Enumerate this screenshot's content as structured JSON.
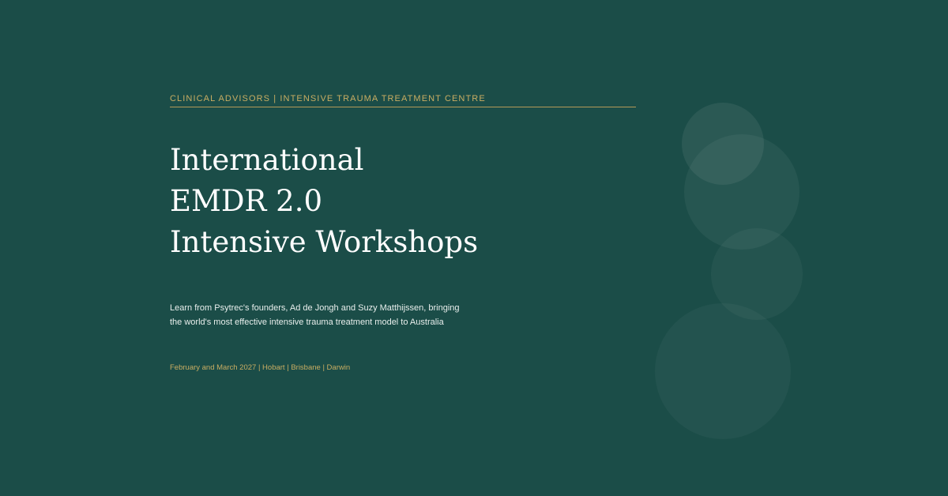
{
  "banner": {
    "eyebrow": "CLINICAL ADVISORS | INTENSIVE TRAUMA TREATMENT CENTRE",
    "title_lines": [
      "International",
      "EMDR 2.0",
      "Intensive Workshops"
    ],
    "lead_lines": [
      "Learn from Psytrec's founders, Ad de Jongh and Suzy Matthijssen, bringing",
      "the world's most effective intensive trauma treatment model to Australia"
    ],
    "meta": "February and March 2027 | Hobart | Brisbane | Darwin"
  },
  "colors": {
    "background": "#1b4d48",
    "accent_gold": "#c9ad62",
    "title_text": "#ffffff",
    "body_text": "#e9efed",
    "decor_circle": "#ffffff"
  }
}
